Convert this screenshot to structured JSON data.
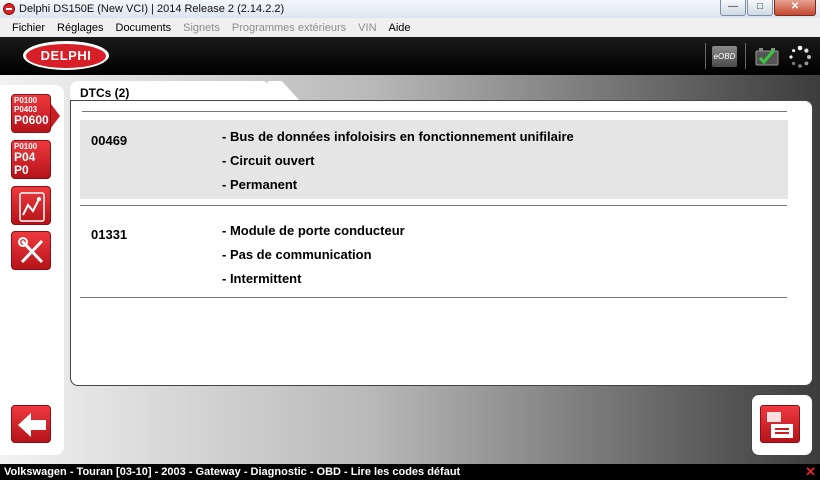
{
  "window": {
    "title": "Delphi DS150E (New VCI) | 2014 Release 2 (2.14.2.2)"
  },
  "menu": {
    "items": [
      {
        "label": "Fichier",
        "enabled": true
      },
      {
        "label": "Réglages",
        "enabled": true
      },
      {
        "label": "Documents",
        "enabled": true
      },
      {
        "label": "Signets",
        "enabled": false
      },
      {
        "label": "Programmes extérieurs",
        "enabled": false
      },
      {
        "label": "VIN",
        "enabled": false
      },
      {
        "label": "Aide",
        "enabled": true
      }
    ]
  },
  "header": {
    "logo_text": "DELPHI",
    "eobd_label": "eOBD",
    "icons": [
      "eobd-icon",
      "battery-check-icon",
      "loading-spinner-icon"
    ]
  },
  "sidebar": {
    "read_codes_lines": [
      "P0100",
      "P0403",
      "P0600"
    ],
    "clear_codes_lines": [
      "P0100",
      "P04",
      "P0"
    ],
    "icons": [
      "read-codes-icon",
      "clear-codes-icon",
      "live-data-icon",
      "tools-icon",
      "back-arrow-icon"
    ]
  },
  "tab": {
    "label": "DTCs (2)"
  },
  "dtcs": [
    {
      "code": "00469",
      "lines": [
        "- Bus de données infoloisirs en fonctionnement unifilaire",
        "- Circuit ouvert",
        "- Permanent"
      ]
    },
    {
      "code": "01331",
      "lines": [
        "- Module de porte conducteur",
        "- Pas de communication",
        "- Intermittent"
      ]
    }
  ],
  "status": {
    "text": "Volkswagen - Touran [03-10] - 2003 - Gateway - Diagnostic - OBD - Lire les codes défaut"
  },
  "colors": {
    "brand_red": "#d81e27",
    "row_shade": "#e5e5e5"
  }
}
